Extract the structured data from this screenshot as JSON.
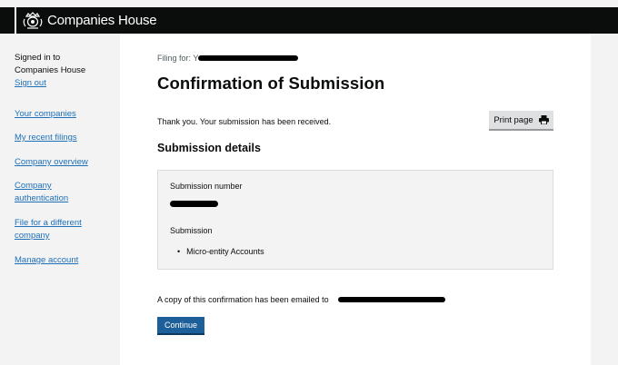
{
  "header": {
    "brand": "Companies House"
  },
  "sidebar": {
    "signed_in_line1": "Signed in to",
    "signed_in_line2": "Companies House",
    "sign_out": "Sign out",
    "links": [
      "Your companies",
      "My recent filings",
      "Company overview",
      "Company authentication",
      "File for a different company",
      "Manage account"
    ]
  },
  "main": {
    "filing_for": "Filing for: Y",
    "title": "Confirmation of Submission",
    "thanks": "Thank you. Your submission has been received.",
    "print_label": "Print page",
    "details_heading": "Submission details",
    "submission_number_label": "Submission number",
    "submission_label": "Submission",
    "submission_item": "Micro-entity Accounts",
    "email_note": "A copy of this confirmation has been emailed to",
    "continue_label": "Continue"
  }
}
